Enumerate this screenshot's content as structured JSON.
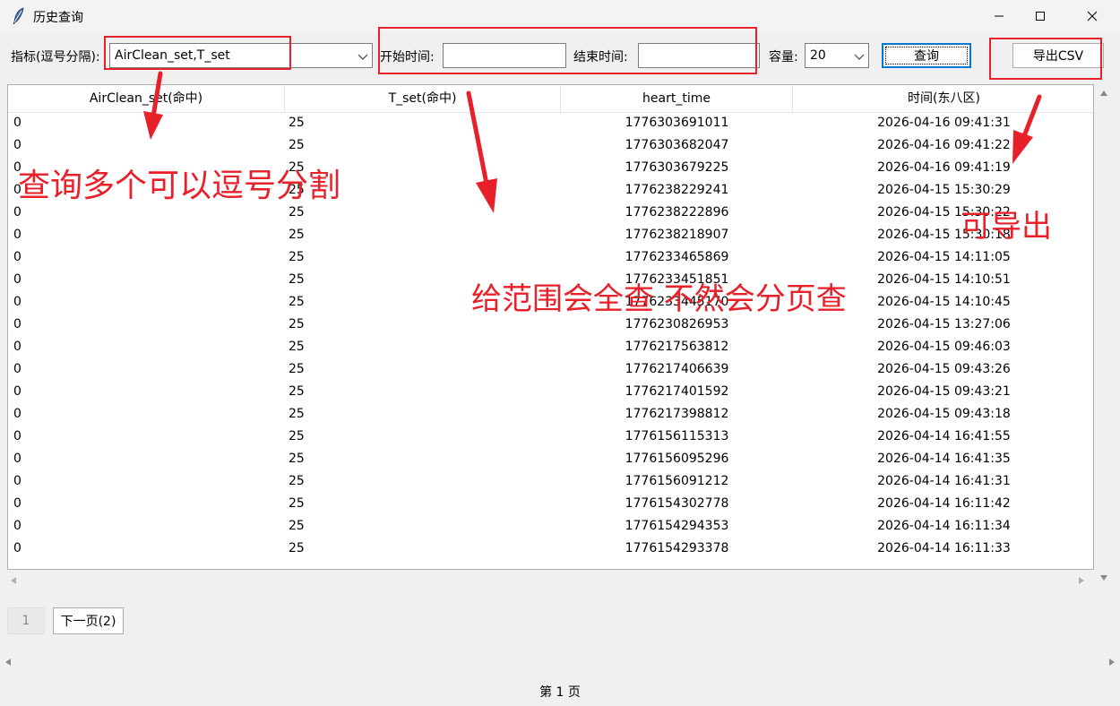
{
  "window": {
    "title": "历史查询"
  },
  "toolbar": {
    "indicator_label": "指标(逗号分隔):",
    "indicator_value": "AirClean_set,T_set",
    "start_label": "开始时间:",
    "end_label": "结束时间:",
    "start_value": "",
    "end_value": "",
    "capacity_label": "容量:",
    "capacity_value": "20",
    "query_label": "查询",
    "export_label": "导出CSV"
  },
  "table": {
    "columns": [
      "AirClean_set(命中)",
      "T_set(命中)",
      "heart_time",
      "时间(东八区)"
    ],
    "rows": [
      [
        "0",
        "25",
        "1776303691011",
        "2026-04-16 09:41:31"
      ],
      [
        "0",
        "25",
        "1776303682047",
        "2026-04-16 09:41:22"
      ],
      [
        "0",
        "25",
        "1776303679225",
        "2026-04-16 09:41:19"
      ],
      [
        "0",
        "25",
        "1776238229241",
        "2026-04-15 15:30:29"
      ],
      [
        "0",
        "25",
        "1776238222896",
        "2026-04-15 15:30:22"
      ],
      [
        "0",
        "25",
        "1776238218907",
        "2026-04-15 15:30:18"
      ],
      [
        "0",
        "25",
        "1776233465869",
        "2026-04-15 14:11:05"
      ],
      [
        "0",
        "25",
        "1776233451851",
        "2026-04-15 14:10:51"
      ],
      [
        "0",
        "25",
        "1776233445170",
        "2026-04-15 14:10:45"
      ],
      [
        "0",
        "25",
        "1776230826953",
        "2026-04-15 13:27:06"
      ],
      [
        "0",
        "25",
        "1776217563812",
        "2026-04-15 09:46:03"
      ],
      [
        "0",
        "25",
        "1776217406639",
        "2026-04-15 09:43:26"
      ],
      [
        "0",
        "25",
        "1776217401592",
        "2026-04-15 09:43:21"
      ],
      [
        "0",
        "25",
        "1776217398812",
        "2026-04-15 09:43:18"
      ],
      [
        "0",
        "25",
        "1776156115313",
        "2026-04-14 16:41:55"
      ],
      [
        "0",
        "25",
        "1776156095296",
        "2026-04-14 16:41:35"
      ],
      [
        "0",
        "25",
        "1776156091212",
        "2026-04-14 16:41:31"
      ],
      [
        "0",
        "25",
        "1776154302778",
        "2026-04-14 16:11:42"
      ],
      [
        "0",
        "25",
        "1776154294353",
        "2026-04-14 16:11:34"
      ],
      [
        "0",
        "25",
        "1776154293378",
        "2026-04-14 16:11:33"
      ]
    ]
  },
  "pagination": {
    "current_page": "1",
    "next_label": "下一页(2)",
    "footer": "第 1 页"
  },
  "annotations": {
    "multi_query": "查询多个可以逗号分割",
    "range_query": "给范围会全查 不然会分页查",
    "export": "可导出"
  },
  "colors": {
    "annotation": "#e8202a",
    "focus": "#0078d4"
  }
}
